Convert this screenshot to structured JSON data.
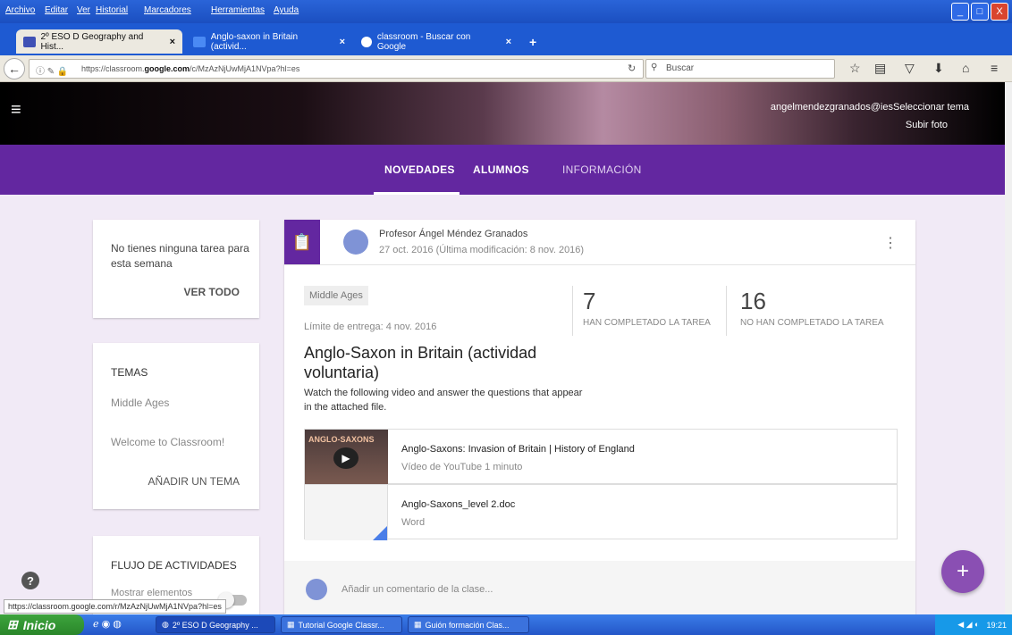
{
  "window": {
    "menu": [
      "Archivo",
      "Editar",
      "Ver",
      "Historial",
      "Marcadores",
      "Herramientas",
      "Ayuda"
    ],
    "controls": [
      "_",
      "□",
      "X"
    ]
  },
  "tabs": [
    {
      "label": "2º ESO D Geography and Hist...",
      "close": "×"
    },
    {
      "label": "Anglo-saxon in Britain (activid...",
      "close": "×"
    },
    {
      "label": "classroom - Buscar con Google",
      "close": "×"
    }
  ],
  "new_tab": "+",
  "url": {
    "prefix": "https://classroom.",
    "domain": "google.com",
    "path": "/c/MzAzNjUwMjA1NVpa?hl=es"
  },
  "search": {
    "placeholder": "Buscar"
  },
  "header": {
    "email": "angelmendezgranados@ies",
    "overlay": "Seleccionar tema",
    "upload": "Subir foto"
  },
  "nav": {
    "tabs": [
      "NOVEDADES",
      "ALUMNOS",
      "INFORMACIÓN"
    ]
  },
  "sidebar": {
    "tasks": {
      "text": "No tienes ninguna tarea para esta semana",
      "link": "VER TODO"
    },
    "topics": {
      "title": "TEMAS",
      "items": [
        "Middle Ages",
        "Welcome to Classroom!"
      ],
      "add": "AÑADIR UN TEMA"
    },
    "stream": {
      "title": "FLUJO DE ACTIVIDADES",
      "toggle_label": "Mostrar elementos"
    }
  },
  "post": {
    "author": "Profesor Ángel Méndez Granados",
    "date": "27 oct. 2016 (Última modificación: 8 nov. 2016)",
    "topic": "Middle Ages",
    "due": "Límite de entrega: 4 nov. 2016",
    "title": "Anglo-Saxon in Britain (actividad voluntaria)",
    "desc": "Watch the following video and answer the questions that appear in the attached file.",
    "stats": [
      {
        "value": "7",
        "label": "HAN COMPLETADO LA TAREA"
      },
      {
        "value": "16",
        "label": "NO HAN COMPLETADO LA TAREA"
      }
    ],
    "attachments": [
      {
        "title": "Anglo-Saxons: Invasion of Britain | History of England",
        "sub": "Vídeo de YouTube   1 minuto",
        "thumb_text": "ANGLO-SAXONS"
      },
      {
        "title": "Anglo-Saxons_level 2.doc",
        "sub": "Word"
      }
    ],
    "comment_placeholder": "Añadir un comentario de la clase..."
  },
  "fab": "+",
  "help": "?",
  "status_url": "https://classroom.google.com/r/MzAzNjUwMjA1NVpa?hl=es",
  "taskbar": {
    "start": "Inicio",
    "items": [
      "2º ESO D Geography ...",
      "Tutorial Google Classr...",
      "Guión formación Clas..."
    ],
    "time": "19:21"
  },
  "colors": {
    "brand": "#6327a0",
    "background": "#f1eaf6",
    "fab": "#8a4fb3"
  }
}
